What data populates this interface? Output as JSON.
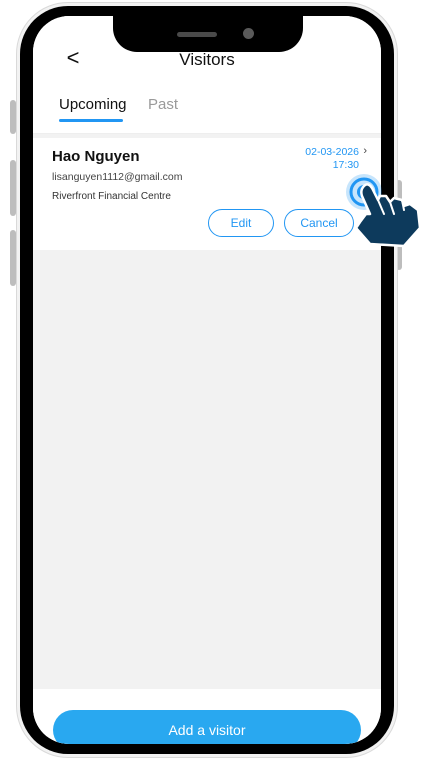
{
  "header": {
    "back_icon": "chevron-left-icon",
    "back_glyph": "<",
    "title": "Visitors"
  },
  "tabs": [
    {
      "label": "Upcoming",
      "active": true
    },
    {
      "label": "Past",
      "active": false
    }
  ],
  "visitors": [
    {
      "name": "Hao Nguyen",
      "email": "lisanguyen1112@gmail.com",
      "location": "Riverfront Financial Centre",
      "date": "02-03-2026",
      "time": "17:30",
      "chevron": "›",
      "edit_label": "Edit",
      "cancel_label": "Cancel"
    }
  ],
  "footer": {
    "add_button_label": "Add a visitor"
  },
  "colors": {
    "accent": "#2196f3",
    "button_fill": "#29a8f0",
    "background": "#f2f2f2",
    "hand": "#0d3a5c"
  },
  "overlay": {
    "icon": "tap-hand-icon"
  }
}
